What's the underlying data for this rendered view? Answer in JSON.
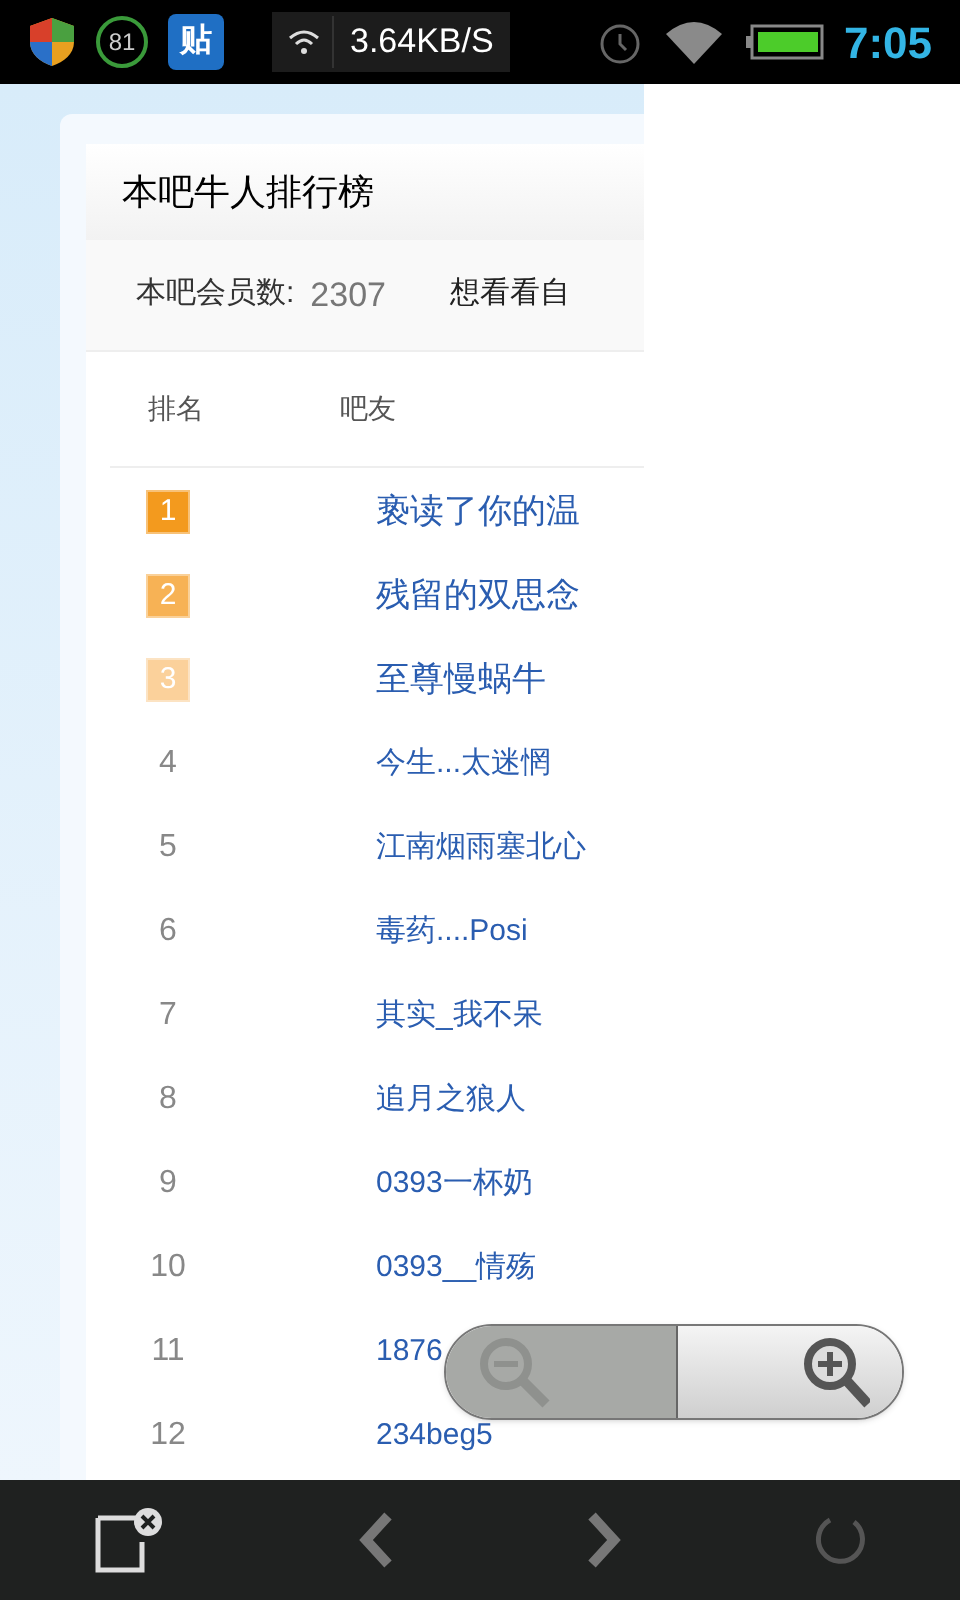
{
  "status_bar": {
    "notification_count": "81",
    "app_badge": "贴",
    "speed": "3.64KB/S",
    "time": "7:05"
  },
  "panel": {
    "title": "本吧牛人排行榜",
    "member_label": "本吧会员数:",
    "member_count": "2307",
    "link": "想看看自"
  },
  "table": {
    "columns": [
      "排名",
      "吧友"
    ],
    "rows": [
      {
        "rank": "1",
        "name": "亵读了你的温",
        "kind": "badge",
        "color": "#f39a1e"
      },
      {
        "rank": "2",
        "name": "残留的双思念",
        "kind": "badge",
        "color": "#f7b255"
      },
      {
        "rank": "3",
        "name": "至尊慢蜗牛",
        "kind": "badge",
        "color": "#fbd19b"
      },
      {
        "rank": "4",
        "name": "今生...太迷惘",
        "kind": "plain"
      },
      {
        "rank": "5",
        "name": "江南烟雨塞北心",
        "kind": "plain"
      },
      {
        "rank": "6",
        "name": "毒药....Posi",
        "kind": "plain"
      },
      {
        "rank": "7",
        "name": "其实_我不呆",
        "kind": "plain"
      },
      {
        "rank": "8",
        "name": "追月之狼人",
        "kind": "plain"
      },
      {
        "rank": "9",
        "name": "0393一杯奶",
        "kind": "plain"
      },
      {
        "rank": "10",
        "name": "0393__情殇",
        "kind": "plain"
      },
      {
        "rank": "11",
        "name": "1876",
        "kind": "plain"
      },
      {
        "rank": "12",
        "name": "234beg5",
        "kind": "plain"
      }
    ]
  },
  "zoom_controls": {
    "zoom_out_disabled": true,
    "zoom_in_disabled": false
  }
}
